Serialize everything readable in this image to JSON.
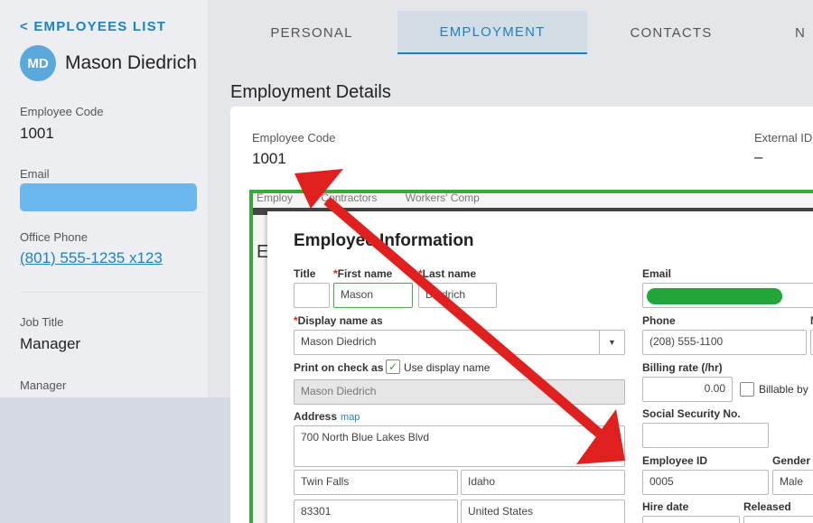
{
  "sidebar": {
    "back_link": "< EMPLOYEES LIST",
    "avatar_initials": "MD",
    "name": "Mason Diedrich",
    "employee_code_label": "Employee Code",
    "employee_code": "1001",
    "email_label": "Email",
    "office_phone_label": "Office Phone",
    "office_phone": "(801) 555-1235 x123",
    "job_title_label": "Job Title",
    "job_title": "Manager",
    "manager_label": "Manager"
  },
  "tabs": [
    "PERSONAL",
    "EMPLOYMENT",
    "CONTACTS",
    "N"
  ],
  "active_tab": "EMPLOYMENT",
  "section_title": "Employment Details",
  "card": {
    "employee_code_label": "Employee Code",
    "employee_code": "1001",
    "external_id_label": "External ID",
    "external_id": "–"
  },
  "embedded": {
    "tabs": [
      "Employ",
      "Contractors",
      "Workers' Comp"
    ],
    "ghost_letter": "E",
    "dialog_title": "Employee Information",
    "title_label": "Title",
    "first_name_label": "First name",
    "first_name": "Mason",
    "last_name_label": "Last name",
    "last_name": "Diedrich",
    "display_name_label": "Display name as",
    "display_name": "Mason Diedrich",
    "print_on_check_label": "Print on check as",
    "use_display_name": "Use display name",
    "print_on_check_value": "Mason Diedrich",
    "address_label": "Address",
    "map_link": "map",
    "street": "700 North Blue Lakes Blvd",
    "city": "Twin Falls",
    "state": "Idaho",
    "zip": "83301",
    "country": "United States",
    "email_label": "Email",
    "phone_label": "Phone",
    "phone": "(208) 555-1100",
    "mobile_label_partial": "M",
    "billing_rate_label": "Billing rate (/hr)",
    "billing_rate": "0.00",
    "billable_label": "Billable by",
    "ssn_label": "Social Security No.",
    "employee_id_label": "Employee ID",
    "employee_id": "0005",
    "gender_label": "Gender",
    "gender": "Male",
    "hire_date_label": "Hire date",
    "released_label": "Released"
  },
  "colors": {
    "accent": "#1f82c0",
    "avatar": "#5ba8dc",
    "frame_green": "#3aa83a",
    "arrow_red": "#e0201e"
  }
}
